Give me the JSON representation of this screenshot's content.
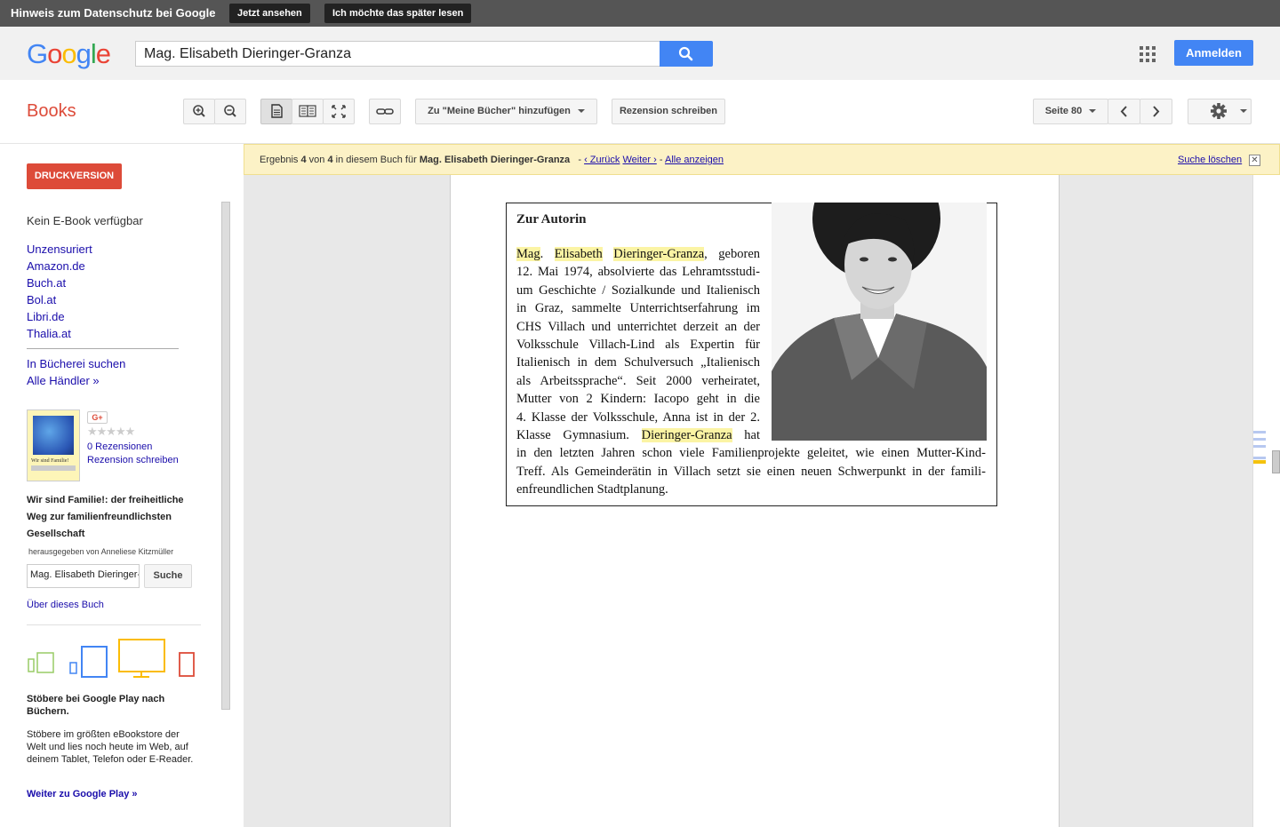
{
  "privacy": {
    "text": "Hinweis zum Datenschutz bei Google",
    "view_button": "Jetzt ansehen",
    "later_button": "Ich möchte das später lesen"
  },
  "header": {
    "logo": "Google",
    "search_value": "Mag. Elisabeth Dieringer-Granza",
    "signin": "Anmelden"
  },
  "toolbar": {
    "books_label": "Books",
    "add_to_my_books": "Zu \"Meine Bücher\" hinzufügen",
    "write_review": "Rezension schreiben",
    "page_label": "Seite 80"
  },
  "left": {
    "print_button": "DRUCKVERSION",
    "no_ebook": "Kein E-Book verfügbar",
    "sellers": [
      "Unzensuriert",
      "Amazon.de",
      "Buch.at",
      "Bol.at",
      "Libri.de",
      "Thalia.at"
    ],
    "library_search": "In Bücherei suchen",
    "all_sellers": "Alle Händler »",
    "reviews_count": "0 Rezensionen",
    "write_review": "Rezension schreiben",
    "book_title": "Wir sind Familie!: der freiheitliche Weg zur familienfreundlichsten Gesellschaft",
    "editor": "herausgegeben von Anneliese Kitzmüller",
    "in_book_search_value": "Mag. Elisabeth Dieringer-Granza",
    "in_book_search_button": "Suche",
    "about_book": "Über dieses Buch",
    "play_heading": "Stöbere bei Google Play nach Büchern.",
    "play_text": "Stöbere im größten eBookstore der Welt und lies noch heute im Web, auf deinem Tablet, Telefon oder E-Reader.",
    "play_link": "Weiter zu Google Play »",
    "cover_title": "Wir sind Familie!"
  },
  "banner": {
    "prefix": "Ergebnis",
    "current": "4",
    "of": "von",
    "total": "4",
    "in_book": "in diesem Buch für",
    "query": "Mag. Elisabeth Dieringer-Granza",
    "sep": "-",
    "back": "‹ Zurück",
    "next": "Weiter ›",
    "show_all": "Alle anzeigen",
    "clear": "Suche löschen"
  },
  "page_content": {
    "box_title": "Zur Autorin",
    "bio_lines_narrow": [
      "12. Mai 1974, absolvierte das Lehramtsstudi-",
      "um Geschichte / Sozialkunde und Italienisch",
      "in Graz, sammelte Unterrichtserfahrung im",
      "CHS Villach und unterrichtet derzeit an der",
      "Volksschule Villach-Lind als Expertin für",
      "Italienisch in dem Schulversuch „Italienisch",
      "als Arbeitssprache“. Seit 2000 verheiratet,",
      "Mutter von 2 Kindern: Iacopo geht in die",
      "4. Klasse der Volksschule, Anna ist in der 2."
    ],
    "bio_first_hl1": "Mag",
    "bio_first_hl2": "Elisabeth",
    "bio_first_hl3": "Dieringer-Granza",
    "bio_first_rest": ", geboren",
    "bio_klasse": "Klasse Gymnasium.",
    "bio_klasse_hl": "Dieringer-Granza",
    "bio_klasse_rest": "hat",
    "bio_lines_wide": [
      "in den letzten Jahren schon viele Familienprojekte geleitet, wie einen Mutter-Kind-",
      "Treff. Als Gemeinderätin in Villach setzt sie einen neuen Schwerpunkt in der famili-",
      "enfreundlichen Stadtplanung."
    ]
  },
  "colors": {
    "google_blue": "#4285f4",
    "books_red": "#dd4b39",
    "highlight": "#fbf4a4",
    "banner_bg": "#fcf2c6"
  }
}
